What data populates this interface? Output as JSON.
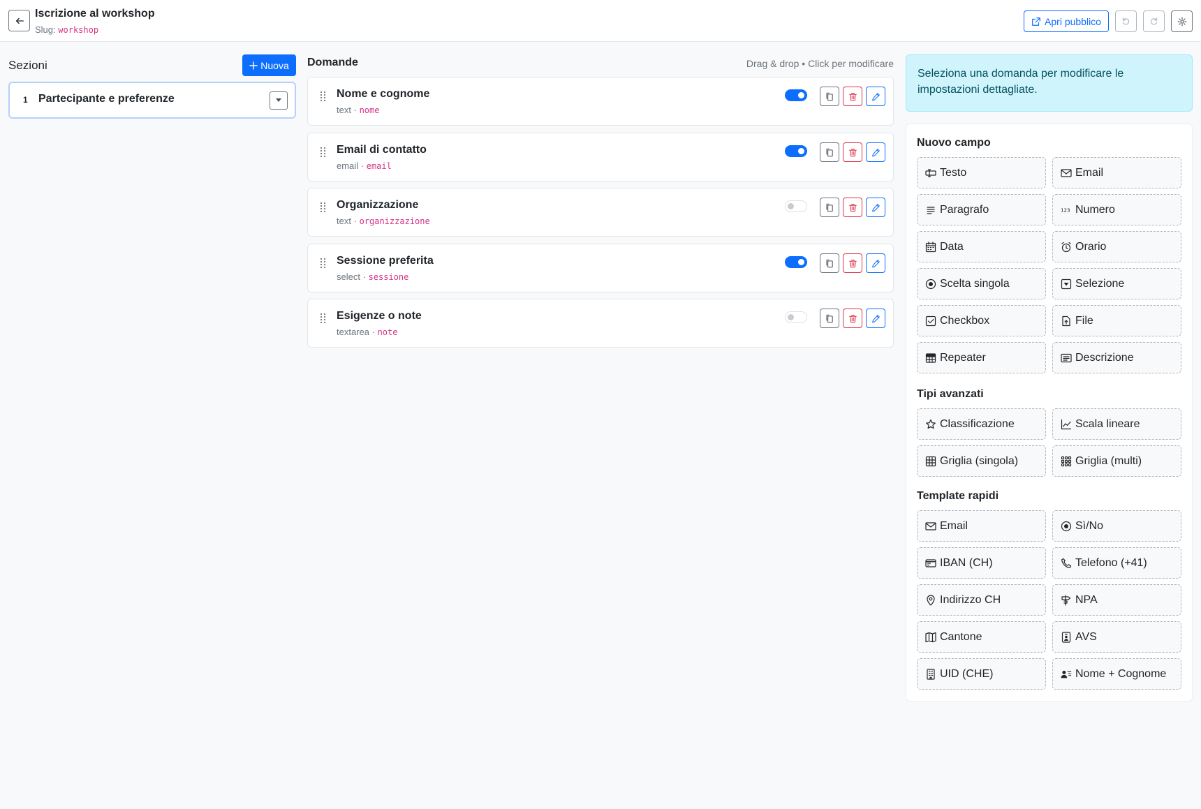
{
  "header": {
    "title": "Iscrizione al workshop",
    "slug_label": "Slug:",
    "slug_value": "workshop",
    "open_public_label": "Apri pubblico"
  },
  "sections": {
    "heading": "Sezioni",
    "new_label": "Nuova",
    "items": [
      {
        "number": "1",
        "name": "Partecipante e preferenze"
      }
    ]
  },
  "questions": {
    "heading": "Domande",
    "hint": "Drag & drop • Click per modificare",
    "items": [
      {
        "label": "Nome e cognome",
        "type": "text",
        "sep": "·",
        "key": "nome",
        "required": true
      },
      {
        "label": "Email di contatto",
        "type": "email",
        "sep": "·",
        "key": "email",
        "required": true
      },
      {
        "label": "Organizzazione",
        "type": "text",
        "sep": "·",
        "key": "organizzazione",
        "required": false
      },
      {
        "label": "Sessione preferita",
        "type": "select",
        "sep": "·",
        "key": "sessione",
        "required": true
      },
      {
        "label": "Esigenze o note",
        "type": "textarea",
        "sep": "·",
        "key": "note",
        "required": false
      }
    ]
  },
  "info_text": "Seleziona una domanda per modificare le impostazioni dettagliate.",
  "palette": {
    "new_field_title": "Nuovo campo",
    "new_field": [
      {
        "label": "Testo",
        "icon": "input-cursor-icon"
      },
      {
        "label": "Email",
        "icon": "envelope-icon"
      },
      {
        "label": "Paragrafo",
        "icon": "text-paragraph-icon"
      },
      {
        "label": "Numero",
        "icon": "numbers-123-icon"
      },
      {
        "label": "Data",
        "icon": "calendar-icon"
      },
      {
        "label": "Orario",
        "icon": "alarm-icon"
      },
      {
        "label": "Scelta singola",
        "icon": "radio-icon"
      },
      {
        "label": "Selezione",
        "icon": "caret-down-square-icon"
      },
      {
        "label": "Checkbox",
        "icon": "check-square-icon"
      },
      {
        "label": "File",
        "icon": "file-arrow-up-icon"
      },
      {
        "label": "Repeater",
        "icon": "table-icon"
      },
      {
        "label": "Descrizione",
        "icon": "card-text-icon"
      }
    ],
    "advanced_title": "Tipi avanzati",
    "advanced": [
      {
        "label": "Classificazione",
        "icon": "star-icon"
      },
      {
        "label": "Scala lineare",
        "icon": "graph-up-icon"
      },
      {
        "label": "Griglia (singola)",
        "icon": "grid-3x3-icon"
      },
      {
        "label": "Griglia (multi)",
        "icon": "grid-dots-icon"
      }
    ],
    "templates_title": "Template rapidi",
    "templates": [
      {
        "label": "Email",
        "icon": "envelope-icon"
      },
      {
        "label": "Sì/No",
        "icon": "radio-icon"
      },
      {
        "label": "IBAN (CH)",
        "icon": "credit-card-icon"
      },
      {
        "label": "Telefono (+41)",
        "icon": "telephone-icon"
      },
      {
        "label": "Indirizzo CH",
        "icon": "geo-pin-icon"
      },
      {
        "label": "NPA",
        "icon": "signpost-icon"
      },
      {
        "label": "Cantone",
        "icon": "map-icon"
      },
      {
        "label": "AVS",
        "icon": "person-badge-icon"
      },
      {
        "label": "UID (CHE)",
        "icon": "building-icon"
      },
      {
        "label": "Nome + Cognome",
        "icon": "person-lines-icon"
      }
    ]
  },
  "colors": {
    "primary": "#0d6efd",
    "danger": "#dc3545",
    "code": "#d63384",
    "info_bg": "#cff4fc"
  }
}
